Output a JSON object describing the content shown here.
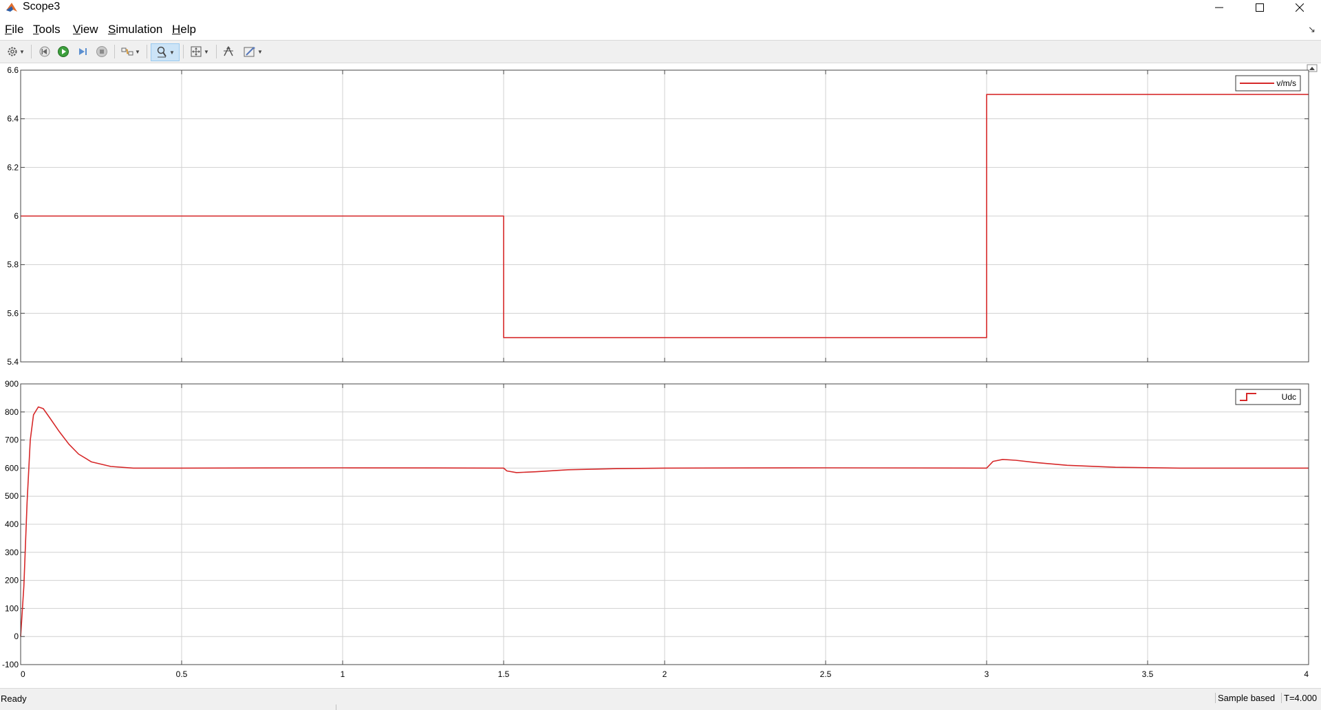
{
  "window": {
    "title": "Scope3"
  },
  "menu": {
    "file": {
      "mnemonic": "F",
      "rest": "ile"
    },
    "tools": {
      "mnemonic": "T",
      "rest": "ools"
    },
    "view": {
      "mnemonic": "V",
      "rest": "iew"
    },
    "simulation": {
      "mnemonic": "S",
      "rest": "imulation"
    },
    "help": {
      "mnemonic": "H",
      "rest": "elp"
    }
  },
  "toolbar": {
    "icons": [
      "settings-icon",
      "step-back-icon",
      "run-icon",
      "step-forward-icon",
      "stop-icon",
      "highlight-icon",
      "zoom-icon",
      "fit-to-view-icon",
      "cursor-measurements-icon",
      "style-edit-icon"
    ],
    "zoom_active": true
  },
  "chart_data": [
    {
      "type": "line",
      "ylim": [
        5.4,
        6.6
      ],
      "yticks": [
        "5.4",
        "5.6",
        "5.8",
        "6",
        "6.2",
        "6.4",
        "6.6"
      ],
      "xlim": [
        0,
        4
      ],
      "grid": true,
      "legend_position": "top-right",
      "series": [
        {
          "name": "v/m/s",
          "color": "#d62728",
          "points": [
            [
              0,
              6.0
            ],
            [
              1.5,
              6.0
            ],
            [
              1.5,
              5.5
            ],
            [
              3.0,
              5.5
            ],
            [
              3.0,
              6.5
            ],
            [
              4.0,
              6.5
            ]
          ]
        }
      ]
    },
    {
      "type": "line",
      "ylim": [
        -100,
        900
      ],
      "yticks": [
        "-100",
        "0",
        "100",
        "200",
        "300",
        "400",
        "500",
        "600",
        "700",
        "800",
        "900"
      ],
      "xlim": [
        0,
        4
      ],
      "xticks": [
        "0",
        "0.5",
        "1",
        "1.5",
        "2",
        "2.5",
        "3",
        "3.5",
        "4"
      ],
      "grid": true,
      "legend_position": "top-right",
      "series": [
        {
          "name": "Udc",
          "color": "#d62728",
          "points": [
            [
              0,
              0
            ],
            [
              0.01,
              180
            ],
            [
              0.02,
              480
            ],
            [
              0.03,
              700
            ],
            [
              0.04,
              790
            ],
            [
              0.055,
              818
            ],
            [
              0.07,
              812
            ],
            [
              0.09,
              780
            ],
            [
              0.12,
              730
            ],
            [
              0.15,
              685
            ],
            [
              0.18,
              650
            ],
            [
              0.22,
              622
            ],
            [
              0.28,
              606
            ],
            [
              0.35,
              600
            ],
            [
              0.5,
              600
            ],
            [
              1.0,
              601
            ],
            [
              1.5,
              600
            ],
            [
              1.51,
              590
            ],
            [
              1.54,
              584
            ],
            [
              1.6,
              587
            ],
            [
              1.7,
              594
            ],
            [
              1.85,
              598
            ],
            [
              2.0,
              600
            ],
            [
              2.5,
              601
            ],
            [
              3.0,
              600
            ],
            [
              3.02,
              624
            ],
            [
              3.05,
              631
            ],
            [
              3.09,
              628
            ],
            [
              3.15,
              620
            ],
            [
              3.25,
              610
            ],
            [
              3.4,
              603
            ],
            [
              3.6,
              600
            ],
            [
              4.0,
              600
            ]
          ]
        }
      ]
    }
  ],
  "status": {
    "ready": "Ready",
    "sample": "Sample based",
    "time": "T=4.000"
  }
}
